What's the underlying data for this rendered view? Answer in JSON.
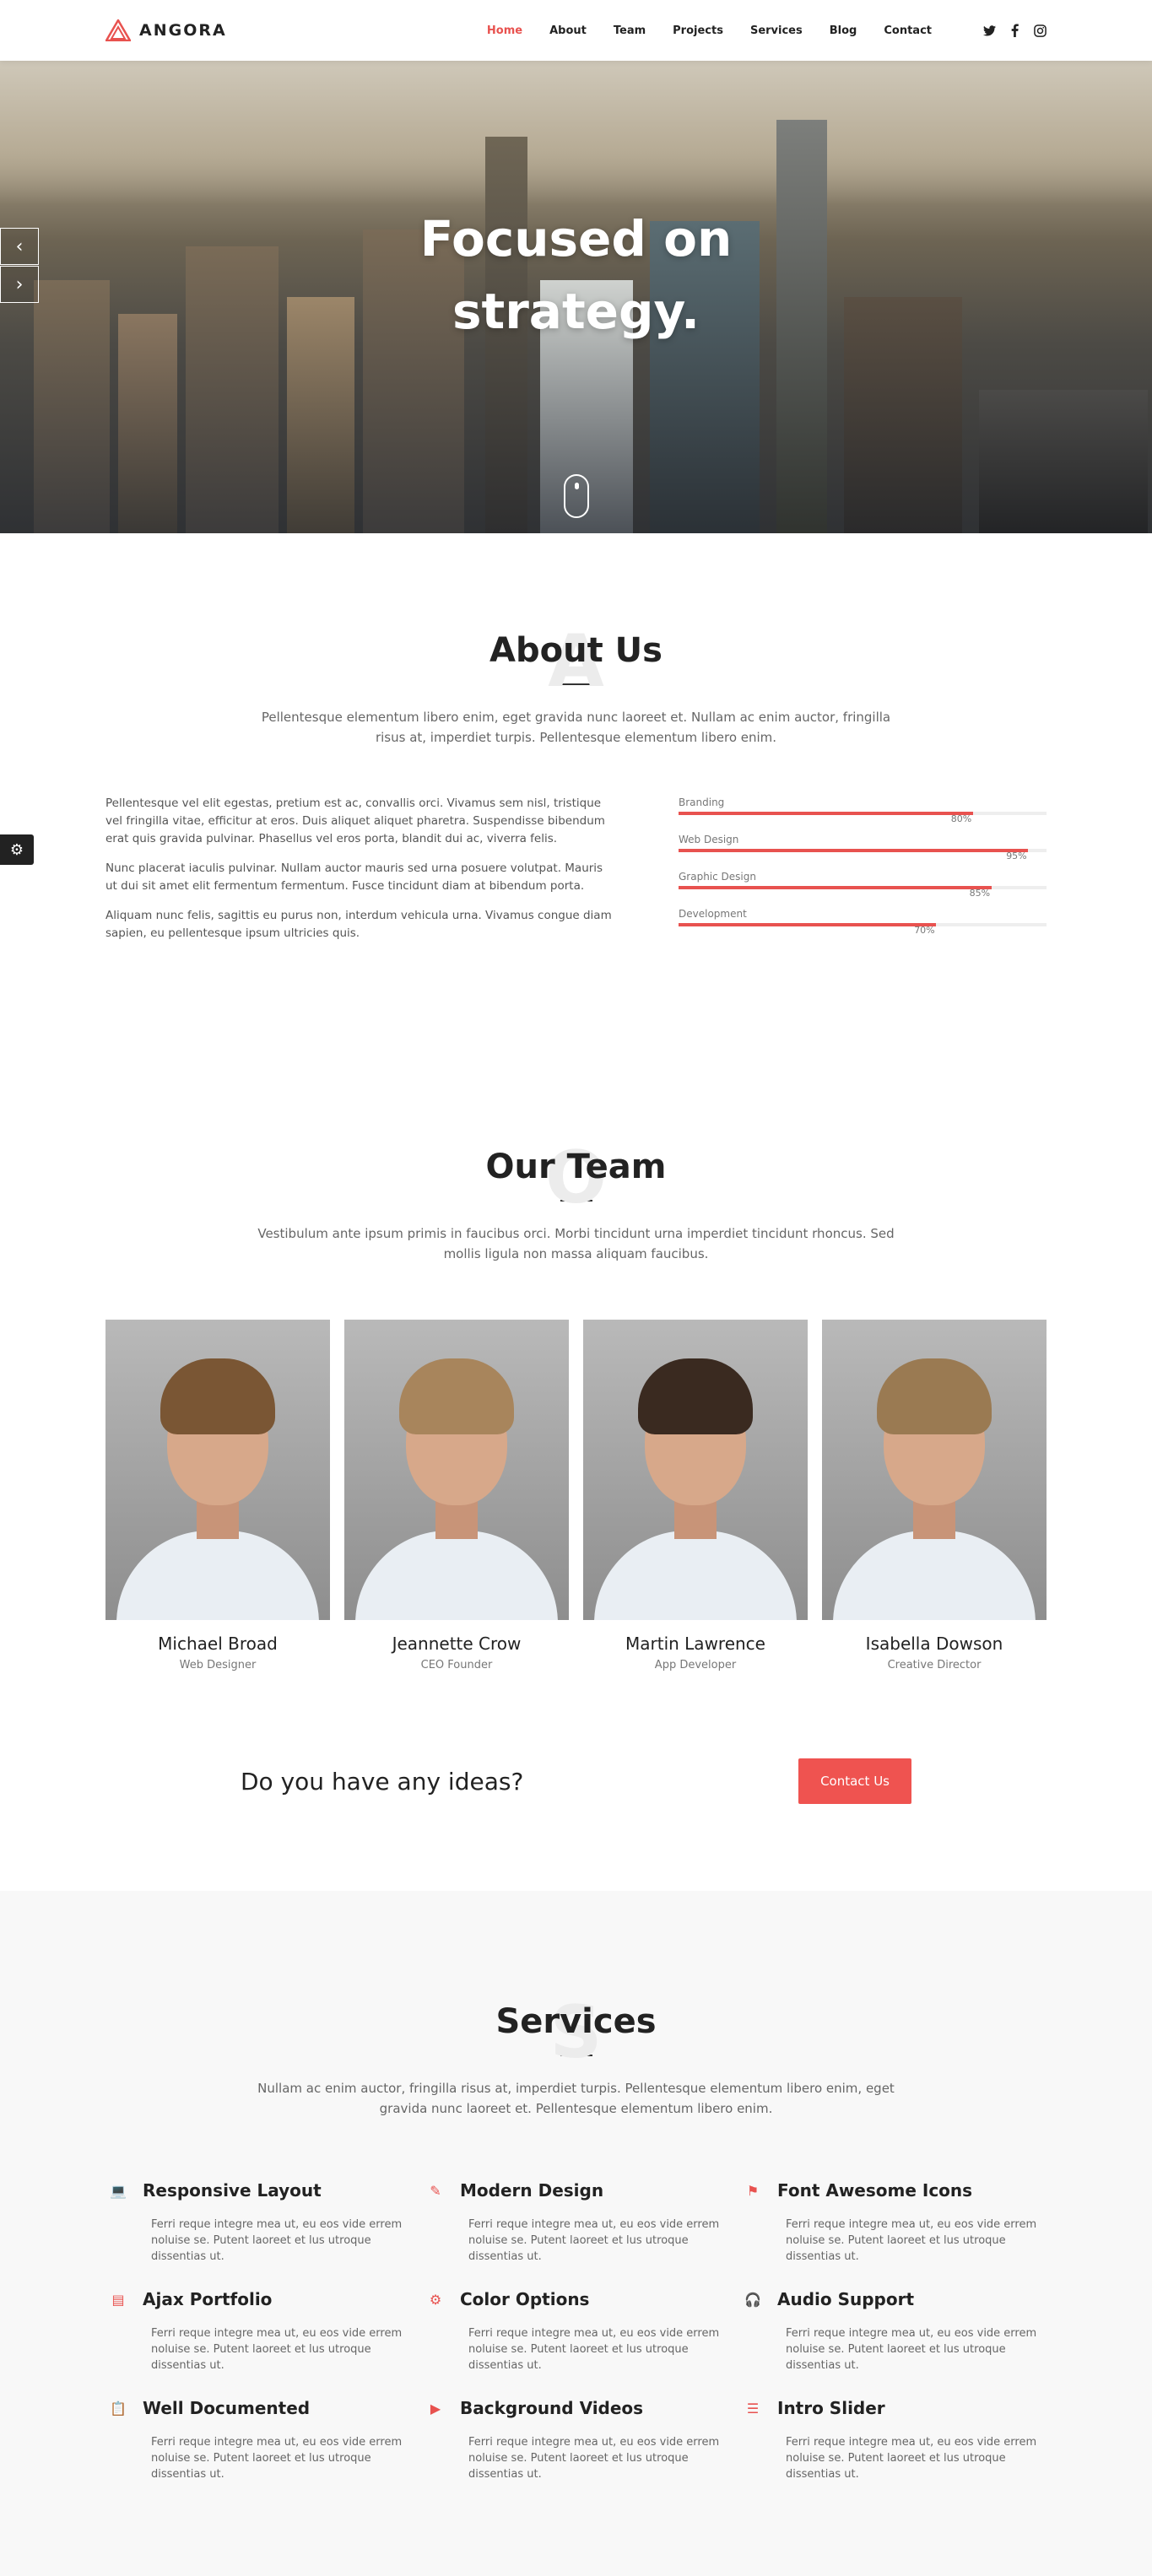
{
  "brand": {
    "name": "ANGORA",
    "accent": "#e8524f"
  },
  "nav": {
    "items": [
      {
        "label": "Home",
        "active": true
      },
      {
        "label": "About",
        "active": false
      },
      {
        "label": "Team",
        "active": false
      },
      {
        "label": "Projects",
        "active": false
      },
      {
        "label": "Services",
        "active": false
      },
      {
        "label": "Blog",
        "active": false
      },
      {
        "label": "Contact",
        "active": false
      }
    ],
    "social": [
      "twitter-icon",
      "facebook-icon",
      "instagram-icon"
    ]
  },
  "hero": {
    "line1": "Focused on",
    "line2": "strategy."
  },
  "about": {
    "title": "About Us",
    "ghost": "A",
    "subtitle": "Pellentesque elementum libero enim, eget gravida nunc laoreet et. Nullam ac enim auctor, fringilla risus at, imperdiet turpis. Pellentesque elementum libero enim.",
    "paragraphs": [
      "Pellentesque vel elit egestas, pretium est ac, convallis orci. Vivamus sem nisl, tristique vel fringilla vitae, efficitur at eros. Duis aliquet aliquet pharetra. Suspendisse bibendum erat quis gravida pulvinar. Phasellus vel eros porta, blandit dui ac, viverra felis.",
      "Nunc placerat iaculis pulvinar. Nullam auctor mauris sed urna posuere volutpat. Mauris ut dui sit amet elit fermentum fermentum. Fusce tincidunt diam at bibendum porta.",
      "Aliquam nunc felis, sagittis eu purus non, interdum vehicula urna. Vivamus congue diam sapien, eu pellentesque ipsum ultricies quis."
    ],
    "skills": [
      {
        "name": "Branding",
        "value": 80,
        "label": "80%"
      },
      {
        "name": "Web Design",
        "value": 95,
        "label": "95%"
      },
      {
        "name": "Graphic Design",
        "value": 85,
        "label": "85%"
      },
      {
        "name": "Development",
        "value": 70,
        "label": "70%"
      }
    ]
  },
  "team": {
    "title": "Our Team",
    "ghost": "O",
    "subtitle": "Vestibulum ante ipsum primis in faucibus orci. Morbi tincidunt urna imperdiet tincidunt rhoncus. Sed mollis ligula non massa aliquam faucibus.",
    "members": [
      {
        "name": "Michael Broad",
        "role": "Web Designer",
        "hair": "#7a5634"
      },
      {
        "name": "Jeannette Crow",
        "role": "CEO Founder",
        "hair": "#a8855c"
      },
      {
        "name": "Martin Lawrence",
        "role": "App Developer",
        "hair": "#3a2a20"
      },
      {
        "name": "Isabella Dowson",
        "role": "Creative Director",
        "hair": "#9a7a52"
      }
    ]
  },
  "cta": {
    "question": "Do you have any ideas?",
    "button": "Contact Us"
  },
  "services": {
    "title": "Services",
    "ghost": "S",
    "subtitle": "Nullam ac enim auctor, fringilla risus at, imperdiet turpis. Pellentesque elementum libero enim, eget gravida nunc laoreet et. Pellentesque elementum libero enim.",
    "items": [
      {
        "title": "Responsive Layout",
        "icon": "laptop-icon",
        "glyph": "💻",
        "desc": "Ferri reque integre mea ut, eu eos vide errem noluise se. Putent laoreet et lus utroque dissentias ut."
      },
      {
        "title": "Modern Design",
        "icon": "design-tools-icon",
        "glyph": "✎",
        "desc": "Ferri reque integre mea ut, eu eos vide errem noluise se. Putent laoreet et lus utroque dissentias ut."
      },
      {
        "title": "Font Awesome Icons",
        "icon": "flag-icon",
        "glyph": "⚑",
        "desc": "Ferri reque integre mea ut, eu eos vide errem noluise se. Putent laoreet et lus utroque dissentias ut."
      },
      {
        "title": "Ajax Portfolio",
        "icon": "id-card-icon",
        "glyph": "▤",
        "desc": "Ferri reque integre mea ut, eu eos vide errem noluise se. Putent laoreet et lus utroque dissentias ut."
      },
      {
        "title": "Color Options",
        "icon": "gear-icon",
        "glyph": "⚙",
        "desc": "Ferri reque integre mea ut, eu eos vide errem noluise se. Putent laoreet et lus utroque dissentias ut."
      },
      {
        "title": "Audio Support",
        "icon": "headset-icon",
        "glyph": "🎧",
        "desc": "Ferri reque integre mea ut, eu eos vide errem noluise se. Putent laoreet et lus utroque dissentias ut."
      },
      {
        "title": "Well Documented",
        "icon": "clipboard-icon",
        "glyph": "📋",
        "desc": "Ferri reque integre mea ut, eu eos vide errem noluise se. Putent laoreet et lus utroque dissentias ut."
      },
      {
        "title": "Background Videos",
        "icon": "video-camera-icon",
        "glyph": "▶",
        "desc": "Ferri reque integre mea ut, eu eos vide errem noluise se. Putent laoreet et lus utroque dissentias ut."
      },
      {
        "title": "Intro Slider",
        "icon": "sliders-icon",
        "glyph": "☰",
        "desc": "Ferri reque integre mea ut, eu eos vide errem noluise se. Putent laoreet et lus utroque dissentias ut."
      }
    ]
  }
}
